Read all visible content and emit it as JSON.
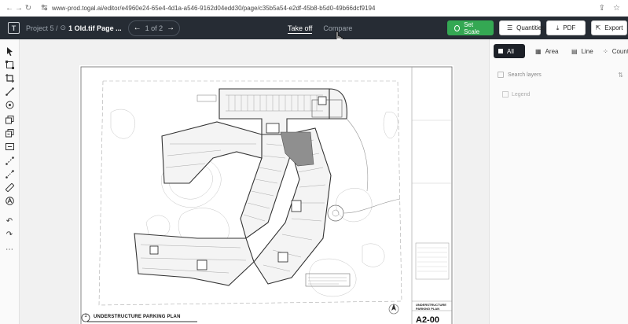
{
  "browser": {
    "url": "www-prod.togal.ai/editor/e4960e24-65e4-4d1a-a546-9162d04edd30/page/c35b5a54-e2df-45b8-b5d0-49b66dcf9194"
  },
  "header": {
    "logo": "T",
    "project_label": "Project 5 /",
    "file_name": "1 Old.tif Page ...",
    "pager_text": "1 of 2",
    "modes": [
      {
        "label": "Take off",
        "active": true
      },
      {
        "label": "Compare",
        "active": false
      }
    ],
    "set_scale_label": "Set Scale",
    "quantities_label": "Quantities",
    "pdf_label": "PDF",
    "export_label": "Export"
  },
  "panel": {
    "tabs": [
      {
        "label": "All",
        "active": true
      },
      {
        "label": "Area",
        "active": false
      },
      {
        "label": "Line",
        "active": false
      },
      {
        "label": "Count",
        "active": false
      }
    ],
    "search_placeholder": "Search layers",
    "legend_label": "Legend"
  },
  "drawing": {
    "title": "UNDERSTRUCTURE PARKING PLAN",
    "title_block_name": "UNDERSTRUCTURE PARKING PLAN",
    "sheet_number": "A2-00",
    "detail_number": "1"
  },
  "colors": {
    "header_bg": "#262c34",
    "set_scale_green": "#34a853",
    "active_tab": "#1d2128"
  }
}
